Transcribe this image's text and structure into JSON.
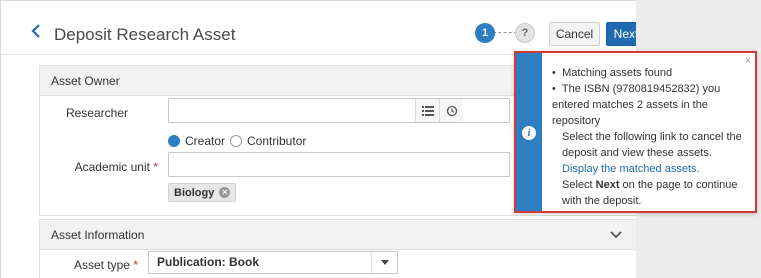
{
  "header": {
    "title": "Deposit Research Asset",
    "steps": [
      "1",
      "?"
    ],
    "cancel_label": "Cancel",
    "next_label": "Next"
  },
  "asset_owner": {
    "section_title": "Asset Owner",
    "researcher_label": "Researcher",
    "researcher_value": "",
    "role_options": [
      {
        "label": "Creator",
        "selected": true
      },
      {
        "label": "Contributor",
        "selected": false
      }
    ],
    "academic_unit_label": "Academic unit",
    "required_mark": "*",
    "academic_unit_value": "",
    "selected_unit": "Biology"
  },
  "asset_information": {
    "section_title": "Asset Information",
    "asset_type_label": "Asset type",
    "asset_type_value": "Publication: Book"
  },
  "notification": {
    "close_glyph": "×",
    "bullet": "•",
    "line1": "Matching assets found",
    "line2": "The ISBN (9780819452832) you entered matches 2 assets in the repository",
    "line3": "Select the following link to cancel the deposit and view these assets.",
    "link": "Display the matched assets.",
    "line4_prefix": "Select",
    "line4_bold": "Next",
    "line4_suffix": "on the page to continue with the deposit."
  },
  "colors": {
    "accent": "#2d7fc1",
    "primary_button": "#1f6ab1",
    "highlight_border": "#d23a3a",
    "required": "#c6272e"
  }
}
